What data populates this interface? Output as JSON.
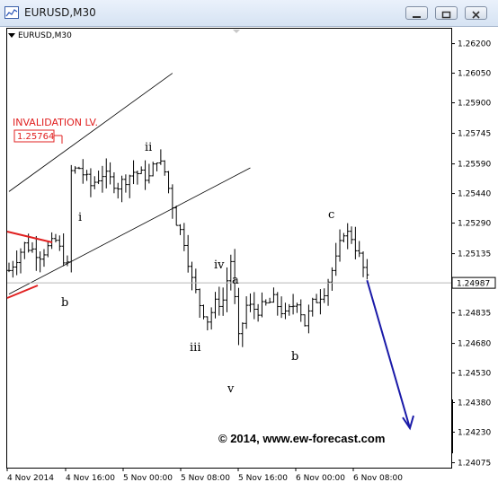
{
  "window": {
    "title": "EURUSD,M30",
    "icon": "chart-window-icon",
    "buttons": [
      "minimize-icon",
      "restore-icon",
      "close-icon"
    ]
  },
  "symbol_label": "EURUSD,M30",
  "annotations": {
    "invalidation_label": "INVALIDATION LV.",
    "invalidation_price": "1.25764",
    "current_price_tag": "1.24987",
    "copyright": "© 2014, www.ew-forecast.com",
    "waves": [
      {
        "id": "b1",
        "text": "b"
      },
      {
        "id": "i",
        "text": "i"
      },
      {
        "id": "ii",
        "text": "ii"
      },
      {
        "id": "iii",
        "text": "iii"
      },
      {
        "id": "iv",
        "text": "iv"
      },
      {
        "id": "v",
        "text": "v"
      },
      {
        "id": "a",
        "text": "a"
      },
      {
        "id": "b2",
        "text": "b"
      },
      {
        "id": "c",
        "text": "c"
      }
    ]
  },
  "colors": {
    "annotation_red": "#e02020",
    "forecast_arrow": "#1a1aa8",
    "bars": "#000000"
  },
  "chart_data": {
    "type": "ohlc",
    "symbol": "EURUSD",
    "timeframe": "M30",
    "y_ticks": [
      "1.26200",
      "1.26050",
      "1.25900",
      "1.25745",
      "1.25590",
      "1.25440",
      "1.25290",
      "1.25135",
      "1.24987",
      "1.24835",
      "1.24680",
      "1.24530",
      "1.24380",
      "1.24230",
      "1.24075"
    ],
    "x_ticks": [
      "4 Nov 2014",
      "4 Nov 16:00",
      "5 Nov 00:00",
      "5 Nov 08:00",
      "5 Nov 16:00",
      "6 Nov 00:00",
      "6 Nov 08:00"
    ],
    "ylim": [
      1.2405,
      1.2628
    ],
    "current_price": 1.24987,
    "invalidation_level": 1.25764,
    "close_path": [
      [
        0,
        1.2505
      ],
      [
        4,
        1.2518
      ],
      [
        8,
        1.2513
      ],
      [
        12,
        1.252
      ],
      [
        15,
        1.2507
      ],
      [
        16,
        1.2555
      ],
      [
        18,
        1.2557
      ],
      [
        21,
        1.2548
      ],
      [
        24,
        1.2554
      ],
      [
        28,
        1.2548
      ],
      [
        32,
        1.2555
      ],
      [
        36,
        1.2552
      ],
      [
        38,
        1.2562
      ],
      [
        40,
        1.2555
      ],
      [
        43,
        1.253
      ],
      [
        45,
        1.252
      ],
      [
        47,
        1.25
      ],
      [
        49,
        1.2488
      ],
      [
        51,
        1.248
      ],
      [
        53,
        1.2488
      ],
      [
        55,
        1.249
      ],
      [
        57,
        1.251
      ],
      [
        59,
        1.247
      ],
      [
        61,
        1.2487
      ],
      [
        64,
        1.2485
      ],
      [
        68,
        1.249
      ],
      [
        71,
        1.2482
      ],
      [
        74,
        1.249
      ],
      [
        76,
        1.2478
      ],
      [
        78,
        1.2488
      ],
      [
        81,
        1.2495
      ],
      [
        84,
        1.251
      ],
      [
        86,
        1.2525
      ],
      [
        88,
        1.2522
      ],
      [
        90,
        1.2512
      ],
      [
        92,
        1.25
      ]
    ],
    "bar_count": 92,
    "channel": {
      "upper": [
        [
          0,
          1.2545
        ],
        [
          42,
          1.2605
        ]
      ],
      "lower": [
        [
          0,
          1.2493
        ],
        [
          62,
          1.2557
        ]
      ]
    },
    "forecast_arrow": [
      [
        92,
        1.25
      ],
      [
        105,
        1.2425
      ]
    ]
  }
}
